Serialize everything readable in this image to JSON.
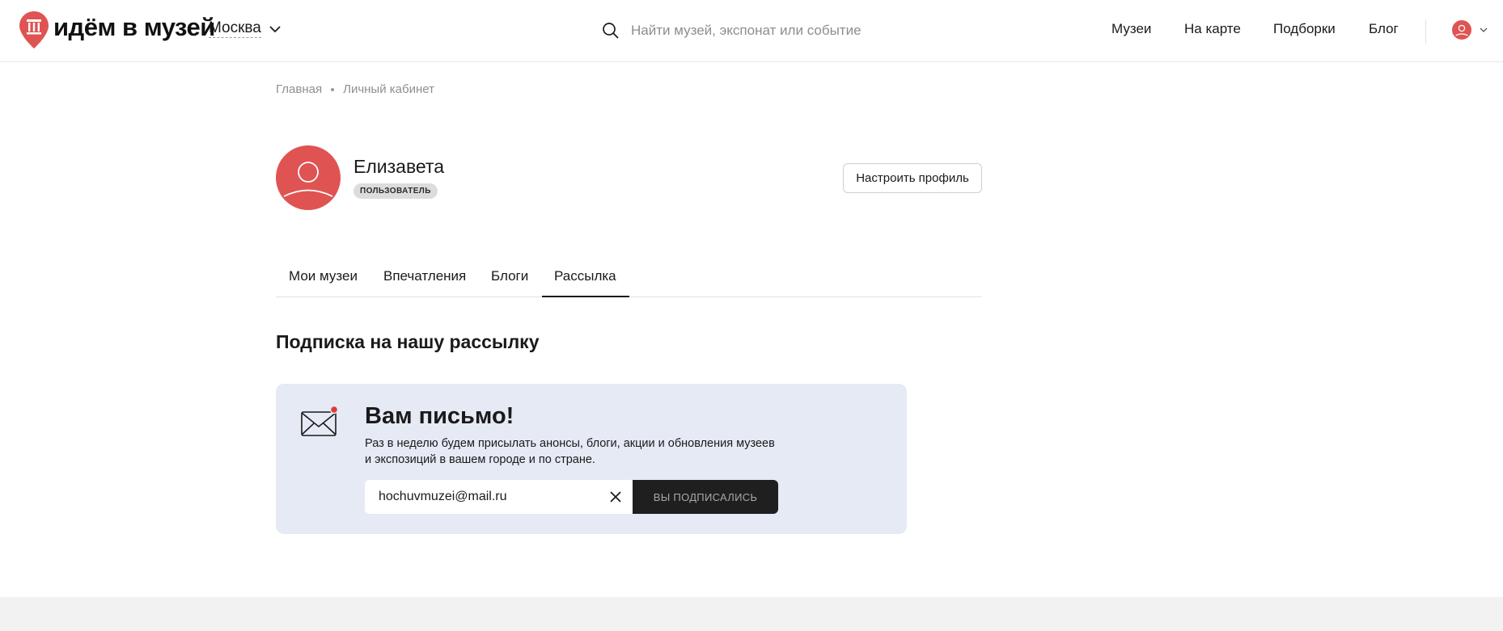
{
  "header": {
    "logo_text": "идём в музей",
    "city": "Москва",
    "search_placeholder": "Найти музей, экспонат или событие",
    "nav": [
      {
        "label": "Музеи"
      },
      {
        "label": "На карте"
      },
      {
        "label": "Подборки"
      },
      {
        "label": "Блог"
      }
    ]
  },
  "breadcrumb": {
    "items": [
      "Главная",
      "Личный кабинет"
    ]
  },
  "profile": {
    "name": "Елизавета",
    "role": "ПОЛЬЗОВАТЕЛЬ",
    "settings_button": "Настроить профиль"
  },
  "tabs": [
    {
      "label": "Мои музеи"
    },
    {
      "label": "Впечатления"
    },
    {
      "label": "Блоги"
    },
    {
      "label": "Рассылка",
      "active": true
    }
  ],
  "newsletter": {
    "section_title": "Подписка на нашу рассылку",
    "card_title": "Вам письмо!",
    "description_line1": "Раз в неделю будем присылать анонсы, блоги, акции и обновления музеев",
    "description_line2": "и экспозиций в вашем городе и по стране.",
    "email_value": "hochuvmuzei@mail.ru",
    "button_label": "ВЫ ПОДПИСАЛИСЬ"
  },
  "colors": {
    "brand_red": "#e05353",
    "card_bg": "#e5eaf5",
    "button_dark": "#1f1f1f",
    "notification_dot": "#e3383b"
  },
  "icons": {
    "logo": "museum-pin-icon",
    "city_toggle": "chevron-down-icon",
    "search": "search-icon",
    "user": "user-avatar-icon",
    "envelope": "envelope-icon",
    "clear": "close-icon"
  }
}
